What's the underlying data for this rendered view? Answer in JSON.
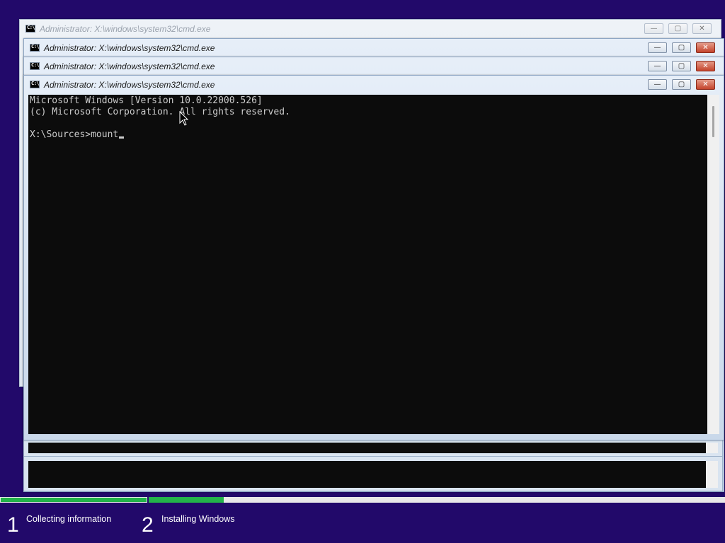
{
  "windows": [
    {
      "title": "Administrator: X:\\windows\\system32\\cmd.exe",
      "state": "inactive"
    },
    {
      "title": "Administrator: X:\\windows\\system32\\cmd.exe",
      "state": "active"
    },
    {
      "title": "Administrator: X:\\windows\\system32\\cmd.exe",
      "state": "active"
    },
    {
      "title": "Administrator: X:\\windows\\system32\\cmd.exe",
      "state": "active"
    }
  ],
  "buttons": {
    "minimize": "—",
    "maximize": "▢",
    "close": "✕"
  },
  "console": {
    "line1": "Microsoft Windows [Version 10.0.22000.526]",
    "line2": "(c) Microsoft Corporation. All rights reserved.",
    "prompt": "X:\\Sources>mount"
  },
  "setup": {
    "steps": [
      {
        "number": "1",
        "label": "Collecting information"
      },
      {
        "number": "2",
        "label": "Installing Windows"
      }
    ],
    "progress": {
      "step1": 1.0,
      "step2": 0.13
    },
    "colors": {
      "background": "#22096a",
      "progress": "#23b34a",
      "console_bg": "#0c0c0c",
      "console_text": "#cccccc"
    }
  }
}
